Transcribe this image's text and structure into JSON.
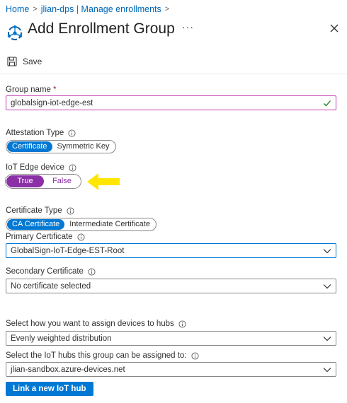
{
  "breadcrumb": {
    "items": [
      "Home",
      "jlian-dps | Manage enrollments"
    ]
  },
  "header": {
    "title": "Add Enrollment Group",
    "more": "···"
  },
  "toolbar": {
    "save_label": "Save"
  },
  "form": {
    "group_name": {
      "label": "Group name",
      "required_mark": "*",
      "value": "globalsign-iot-edge-est"
    },
    "attestation": {
      "label": "Attestation Type",
      "options": [
        "Certificate",
        "Symmetric Key"
      ],
      "selected": "Certificate"
    },
    "iot_edge": {
      "label": "IoT Edge device",
      "options": [
        "True",
        "False"
      ],
      "selected": "True"
    },
    "cert_type": {
      "label": "Certificate Type",
      "options": [
        "CA Certificate",
        "Intermediate Certificate"
      ],
      "selected": "CA Certificate"
    },
    "primary_cert": {
      "label": "Primary Certificate",
      "value": "GlobalSign-IoT-Edge-EST-Root"
    },
    "secondary_cert": {
      "label": "Secondary Certificate",
      "value": "No certificate selected"
    },
    "assign_policy": {
      "label": "Select how you want to assign devices to hubs",
      "value": "Evenly weighted distribution"
    },
    "hubs": {
      "label": "Select the IoT hubs this group can be assigned to:",
      "value": "jlian-sandbox.azure-devices.net"
    },
    "link_button": "Link a new IoT hub"
  },
  "colors": {
    "accent": "#0078d4",
    "edge_toggle": "#8b2fa7",
    "annotation_arrow": "#ffe600"
  }
}
